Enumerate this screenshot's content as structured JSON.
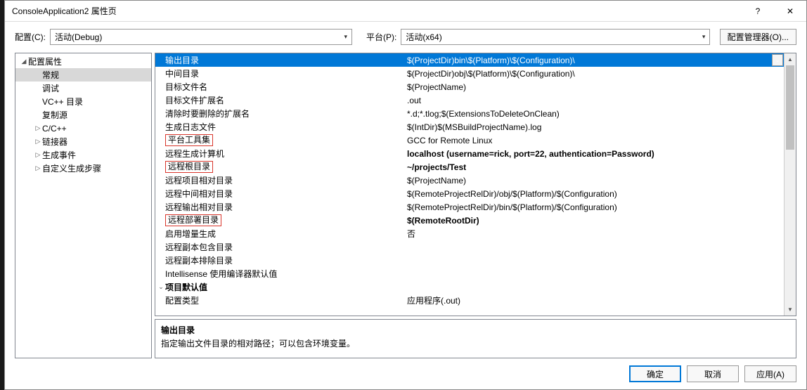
{
  "title": "ConsoleApplication2 属性页",
  "help_symbol": "?",
  "close_symbol": "✕",
  "config_label": "配置(C):",
  "config_value": "活动(Debug)",
  "platform_label": "平台(P):",
  "platform_value": "活动(x64)",
  "cfg_mgr": "配置管理器(O)...",
  "tree": {
    "root": "配置属性",
    "items": [
      "常规",
      "调试",
      "VC++ 目录",
      "复制源",
      "C/C++",
      "链接器",
      "生成事件",
      "自定义生成步骤"
    ]
  },
  "grid": [
    {
      "label": "输出目录",
      "value": "$(ProjectDir)bin\\$(Platform)\\$(Configuration)\\",
      "sel": true,
      "dd": true
    },
    {
      "label": "中间目录",
      "value": "$(ProjectDir)obj\\$(Platform)\\$(Configuration)\\"
    },
    {
      "label": "目标文件名",
      "value": "$(ProjectName)"
    },
    {
      "label": "目标文件扩展名",
      "value": ".out"
    },
    {
      "label": "清除时要删除的扩展名",
      "value": "*.d;*.tlog;$(ExtensionsToDeleteOnClean)"
    },
    {
      "label": "生成日志文件",
      "value": "$(IntDir)$(MSBuildProjectName).log"
    },
    {
      "label": "平台工具集",
      "value": "GCC for Remote Linux",
      "boxed": true
    },
    {
      "label": "远程生成计算机",
      "value": "localhost (username=rick, port=22, authentication=Password)",
      "bold": true
    },
    {
      "label": "远程根目录",
      "value": "~/projects/Test",
      "boxed": true,
      "bold": true
    },
    {
      "label": "远程项目相对目录",
      "value": "$(ProjectName)"
    },
    {
      "label": "远程中间相对目录",
      "value": "$(RemoteProjectRelDir)/obj/$(Platform)/$(Configuration)"
    },
    {
      "label": "远程输出相对目录",
      "value": "$(RemoteProjectRelDir)/bin/$(Platform)/$(Configuration)"
    },
    {
      "label": "远程部署目录",
      "value": "$(RemoteRootDir)",
      "boxed": true,
      "bold": true
    },
    {
      "label": "启用增量生成",
      "value": "否"
    },
    {
      "label": "远程副本包含目录",
      "value": ""
    },
    {
      "label": "远程副本排除目录",
      "value": ""
    },
    {
      "label": "Intellisense 使用编译器默认值",
      "value": ""
    }
  ],
  "section2": "项目默认值",
  "section2_row": {
    "label": "配置类型",
    "value": "应用程序(.out)"
  },
  "desc_title": "输出目录",
  "desc_text": "指定输出文件目录的相对路径；可以包含环境变量。",
  "ok": "确定",
  "cancel": "取消",
  "apply": "应用(A)"
}
